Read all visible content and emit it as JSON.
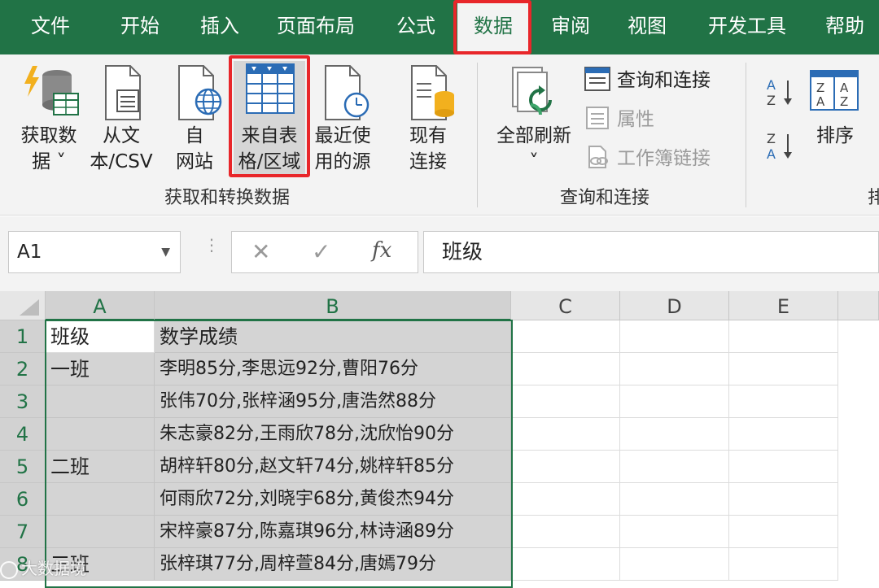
{
  "menu": {
    "tabs": [
      {
        "label": "文件"
      },
      {
        "label": "开始"
      },
      {
        "label": "插入"
      },
      {
        "label": "页面布局"
      },
      {
        "label": "公式"
      },
      {
        "label": "数据"
      },
      {
        "label": "审阅"
      },
      {
        "label": "视图"
      },
      {
        "label": "开发工具"
      },
      {
        "label": "帮助"
      }
    ],
    "active_tab": "数据"
  },
  "ribbon": {
    "group1": {
      "buttons": [
        {
          "line1": "获取数",
          "line2": "据 ˅",
          "icon": "database-lightning-icon"
        },
        {
          "line1": "从文",
          "line2": "本/CSV",
          "icon": "text-file-icon"
        },
        {
          "line1": "自",
          "line2": "网站",
          "icon": "web-globe-icon"
        },
        {
          "line1": "来自表",
          "line2": "格/区域",
          "icon": "table-icon"
        },
        {
          "line1": "最近使",
          "line2": "用的源",
          "icon": "recent-clock-icon"
        },
        {
          "line1": "现有",
          "line2": "连接",
          "icon": "existing-connection-icon"
        }
      ],
      "label": "获取和转换数据"
    },
    "group2": {
      "refresh": {
        "line1": "全部刷新",
        "line2": "˅",
        "icon": "refresh-icon"
      },
      "items": [
        {
          "label": "查询和连接",
          "icon": "queries-icon",
          "disabled": false
        },
        {
          "label": "属性",
          "icon": "properties-icon",
          "disabled": true
        },
        {
          "label": "工作簿链接",
          "icon": "workbook-links-icon",
          "disabled": true
        }
      ],
      "label": "查询和连接"
    },
    "group3": {
      "sort_label": "排序",
      "sort_az_icon": "sort-az-icon",
      "sort_za_icon": "sort-za-icon",
      "label": "排"
    }
  },
  "formula_bar": {
    "name_box": "A1",
    "cancel_symbol": "✕",
    "enter_symbol": "✓",
    "fx": "fx",
    "content": "班级"
  },
  "sheet": {
    "columns": [
      "A",
      "B",
      "C",
      "D",
      "E"
    ],
    "rows": [
      {
        "num": "1",
        "a": "班级",
        "b": "数学成绩"
      },
      {
        "num": "2",
        "a": "一班",
        "b": "李明85分,李思远92分,曹阳76分"
      },
      {
        "num": "3",
        "a": "",
        "b": "张伟70分,张梓涵95分,唐浩然88分"
      },
      {
        "num": "4",
        "a": "",
        "b": "朱志豪82分,王雨欣78分,沈欣怡90分"
      },
      {
        "num": "5",
        "a": "二班",
        "b": "胡梓轩80分,赵文轩74分,姚梓轩85分"
      },
      {
        "num": "6",
        "a": "",
        "b": "何雨欣72分,刘晓宇68分,黄俊杰94分"
      },
      {
        "num": "7",
        "a": "",
        "b": "宋梓豪87分,陈嘉琪96分,林诗涵89分"
      },
      {
        "num": "8",
        "a": "三班",
        "b": "张梓琪77分,周梓萱84分,唐嫣79分"
      }
    ]
  },
  "watermark": "大数据境",
  "colors": {
    "excel_green": "#217346",
    "highlight_red": "#e8262a"
  }
}
